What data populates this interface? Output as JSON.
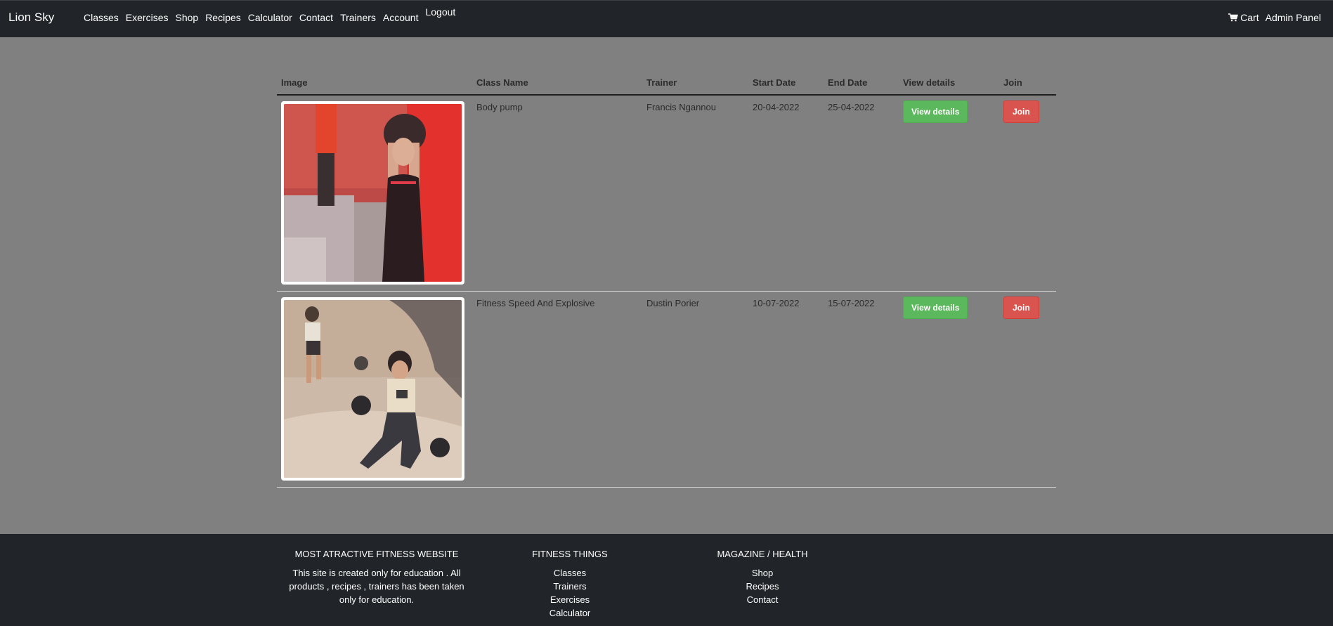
{
  "navbar": {
    "brand": "Lion Sky",
    "links": [
      "Classes",
      "Exercises",
      "Shop",
      "Recipes",
      "Calculator",
      "Contact",
      "Trainers",
      "Account",
      "Logout"
    ],
    "cart_label": "Cart",
    "admin_label": "Admin Panel",
    "cart_icon": "shopping-cart-icon"
  },
  "table": {
    "headers": [
      "Image",
      "Class Name",
      "Trainer",
      "Start Date",
      "End Date",
      "View details",
      "Join"
    ],
    "rows": [
      {
        "class_name": "Body pump",
        "trainer": "Francis Ngannou",
        "start_date": "20-04-2022",
        "end_date": "25-04-2022",
        "details_button": "View details",
        "join_button": "Join",
        "image_alt": "woman lifting kettlebell overhead"
      },
      {
        "class_name": "Fitness Speed And Explosive",
        "trainer": "Dustin Porier",
        "start_date": "10-07-2022",
        "end_date": "15-07-2022",
        "details_button": "View details",
        "join_button": "Join",
        "image_alt": "women lunging with weights"
      }
    ]
  },
  "footer": {
    "col1": {
      "title": "MOST ATRACTIVE FITNESS WEBSITE",
      "text": "This site is created only for education . All products , recipes , trainers has been taken only for education."
    },
    "col2": {
      "title": "FITNESS THINGS",
      "links": [
        "Classes",
        "Trainers",
        "Exercises",
        "Calculator"
      ]
    },
    "col3": {
      "title": "MAGAZINE / HEALTH",
      "links": [
        "Shop",
        "Recipes",
        "Contact"
      ]
    }
  },
  "colors": {
    "page_bg": "#808080",
    "navbar_bg": "#212529",
    "button_green": "#5cb85c",
    "button_red": "#d9534f"
  }
}
